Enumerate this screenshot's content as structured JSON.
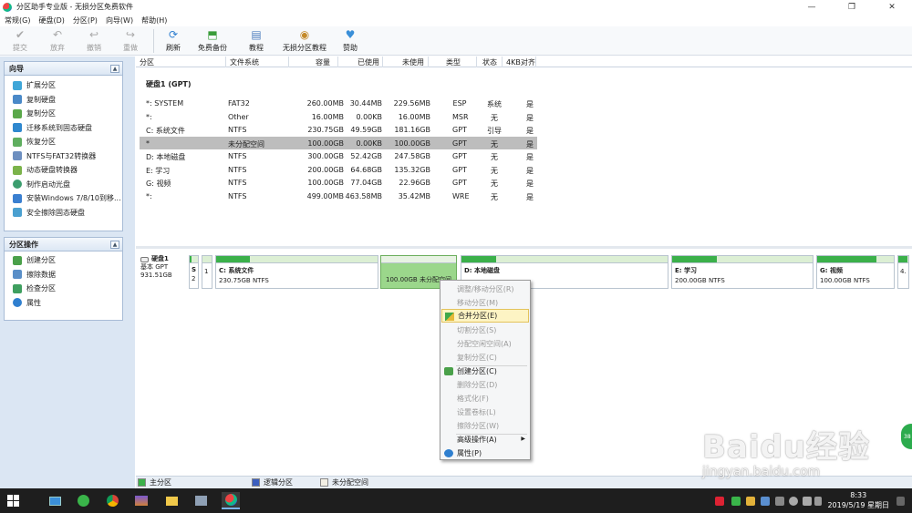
{
  "window": {
    "title": "分区助手专业版 - 无损分区免费软件",
    "controls": [
      "—",
      "❐",
      "✕"
    ]
  },
  "menu": [
    "常规(G)",
    "硬盘(D)",
    "分区(P)",
    "向导(W)",
    "帮助(H)"
  ],
  "toolbar": {
    "commit": "提交",
    "discard": "放弃",
    "undo": "撤销",
    "redo": "重做",
    "refresh": "刷新",
    "backup": "免费备份",
    "tutorial": "教程",
    "lossless_tutorial": "无损分区教程",
    "donate": "赞助"
  },
  "wizard_panel": {
    "title": "向导",
    "items": [
      "扩展分区",
      "复制硬盘",
      "复制分区",
      "迁移系统到固态硬盘",
      "恢复分区",
      "NTFS与FAT32转换器",
      "动态硬盘转换器",
      "制作启动光盘",
      "安装Windows 7/8/10到移...",
      "安全擦除固态硬盘"
    ]
  },
  "partition_panel": {
    "title": "分区操作",
    "items": [
      "创建分区",
      "擦除数据",
      "检查分区",
      "属性"
    ]
  },
  "table": {
    "columns": [
      "分区",
      "文件系统",
      "容量",
      "已使用",
      "未使用",
      "类型",
      "状态",
      "4KB对齐"
    ],
    "disk_label": "硬盘1 (GPT)",
    "rows": [
      [
        "*: SYSTEM",
        "FAT32",
        "260.00MB",
        "30.44MB",
        "229.56MB",
        "ESP",
        "系统",
        "是"
      ],
      [
        "*:",
        "Other",
        "16.00MB",
        "0.00KB",
        "16.00MB",
        "MSR",
        "无",
        "是"
      ],
      [
        "C: 系统文件",
        "NTFS",
        "230.75GB",
        "49.59GB",
        "181.16GB",
        "GPT",
        "引导",
        "是"
      ],
      [
        "*",
        "未分配空间",
        "100.00GB",
        "0.00KB",
        "100.00GB",
        "GPT",
        "无",
        "是"
      ],
      [
        "D: 本地磁盘",
        "NTFS",
        "300.00GB",
        "52.42GB",
        "247.58GB",
        "GPT",
        "无",
        "是"
      ],
      [
        "E: 学习",
        "NTFS",
        "200.00GB",
        "64.68GB",
        "135.32GB",
        "GPT",
        "无",
        "是"
      ],
      [
        "G: 视频",
        "NTFS",
        "100.00GB",
        "77.04GB",
        "22.96GB",
        "GPT",
        "无",
        "是"
      ],
      [
        "*:",
        "NTFS",
        "499.00MB",
        "463.58MB",
        "35.42MB",
        "WRE",
        "无",
        "是"
      ]
    ],
    "selected_row": 3
  },
  "diskmap": {
    "disk_name": "硬盘1",
    "disk_type": "基本 GPT",
    "disk_size": "931.51GB",
    "small_blocks": [
      {
        "name": "S",
        "info": "2"
      },
      {
        "name": "",
        "info": "1"
      }
    ],
    "partitions": [
      {
        "name": "C: 系统文件",
        "info": "230.75GB NTFS",
        "used": 0.21
      },
      {
        "name": "",
        "info": "100.00GB 未分配空间",
        "used": 0
      },
      {
        "name": "D: 本地磁盘",
        "info": "",
        "used": 0.17
      },
      {
        "name": "E: 学习",
        "info": "200.00GB NTFS",
        "used": 0.32
      },
      {
        "name": "G: 视频",
        "info": "100.00GB NTFS",
        "used": 0.77
      },
      {
        "name": "",
        "info": "4.",
        "used": 0.9
      }
    ]
  },
  "context_menu": {
    "items": [
      {
        "label": "调整/移动分区(R)",
        "enabled": false
      },
      {
        "label": "移动分区(M)",
        "enabled": false
      },
      {
        "label": "合并分区(E)",
        "enabled": true,
        "highlighted": true
      },
      {
        "label": "切割分区(S)",
        "enabled": false
      },
      {
        "label": "分配空闲空间(A)",
        "enabled": false
      },
      {
        "label": "复制分区(C)",
        "enabled": false
      },
      {
        "label": "创建分区(C)",
        "enabled": true
      },
      {
        "label": "删除分区(D)",
        "enabled": false
      },
      {
        "label": "格式化(F)",
        "enabled": false
      },
      {
        "label": "设置卷标(L)",
        "enabled": false
      },
      {
        "label": "擦除分区(W)",
        "enabled": false
      },
      {
        "label": "高级操作(A)",
        "enabled": true,
        "submenu": true
      },
      {
        "label": "属性(P)",
        "enabled": true
      }
    ]
  },
  "legend": [
    "主分区",
    "逻辑分区",
    "未分配空间"
  ],
  "badge": "38",
  "watermark": {
    "line1": "Baidu经验",
    "line2": "jingyan.baidu.com"
  },
  "taskbar": {
    "time": "8:33",
    "date": "2019/5/19 星期日"
  },
  "colors": {
    "accent_green": "#3bb04a",
    "selected_row": "#bdbdbd",
    "sidebar_bg": "#dbe6f3",
    "logical_blue": "#3c5fbf"
  }
}
